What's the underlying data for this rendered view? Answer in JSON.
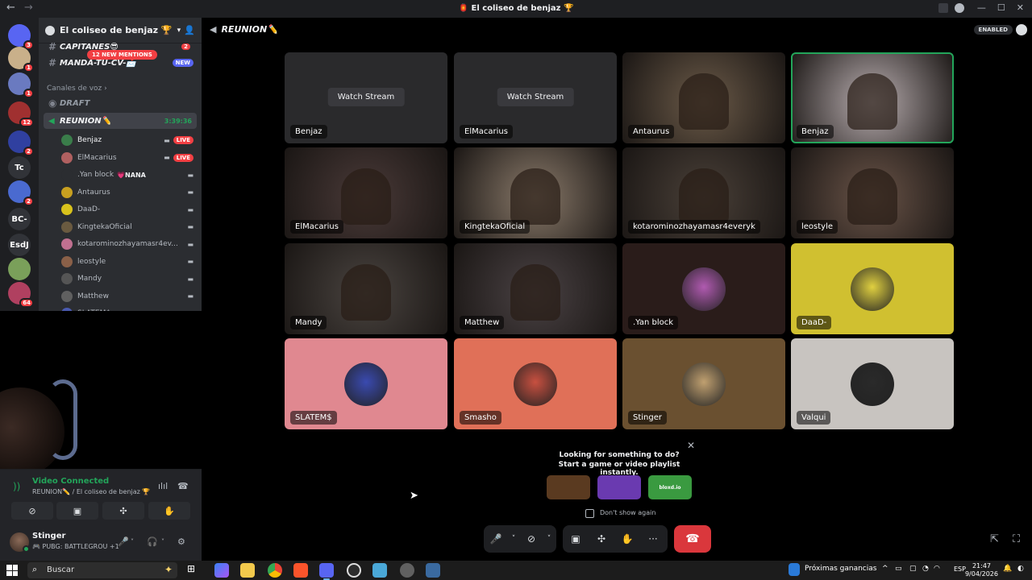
{
  "titlebar": {
    "title": "🏮 El coliseo de benjaz 🏆"
  },
  "server": {
    "name": "El coliseo de benjaz 🏆",
    "mentions_pill": "12 NEW MENTIONS",
    "channels": [
      {
        "name": "CAPITANES😎",
        "badge": "2"
      },
      {
        "name": "MANDA-TU-CV-📩",
        "badge": "NEW"
      }
    ],
    "voice_category": "Canales de voz",
    "voice_channels": [
      {
        "name": "DRAFT"
      },
      {
        "name": "REUNION✏️",
        "timer": "3:39:36"
      }
    ],
    "members": [
      {
        "name": "Benjaz",
        "live": "LIVE",
        "av": "#3a7d4a"
      },
      {
        "name": "ElMacarius",
        "live": "LIVE",
        "av": "#b06060"
      },
      {
        "name": ".Yan block",
        "tag": "💗NANA",
        "av": "#2b2d31"
      },
      {
        "name": "Antaurus",
        "av": "#c8a020"
      },
      {
        "name": "DaaD-",
        "av": "#d8c21c"
      },
      {
        "name": "KingtekaOficial",
        "av": "#6a5a40"
      },
      {
        "name": "kotarominozhayamasr4ev...",
        "av": "#c07090"
      },
      {
        "name": "leostyle",
        "av": "#8a6048"
      },
      {
        "name": "Mandy",
        "av": "#555"
      },
      {
        "name": "Matthew",
        "av": "#606060"
      },
      {
        "name": "SLATEM$",
        "av": "#4a5ab0"
      }
    ],
    "rail": [
      {
        "label": "",
        "badge": "3",
        "color": "#5865f2"
      },
      {
        "label": "",
        "badge": "1",
        "color": "#c9b08a"
      },
      {
        "label": "",
        "badge": "1",
        "color": "#6a7ac0"
      },
      {
        "label": "",
        "badge": "12",
        "color": "#a03030"
      },
      {
        "label": "",
        "badge": "2",
        "color": "#3040a0"
      },
      {
        "label": "Tc",
        "badge": "",
        "color": "#313338"
      },
      {
        "label": "",
        "badge": "2",
        "color": "#4a6ad0"
      },
      {
        "label": "BC-",
        "badge": "",
        "color": "#313338"
      },
      {
        "label": "EsdJ",
        "badge": "",
        "color": "#313338"
      },
      {
        "label": "",
        "badge": "",
        "color": "#7aa05a"
      },
      {
        "label": "",
        "badge": "64",
        "color": "#b04060"
      }
    ]
  },
  "voice_panel": {
    "status": "Video Connected",
    "location": "REUNION✏️ / El coliseo de benjaz 🏆"
  },
  "user": {
    "name": "Stinger",
    "status": "🎮 PUBG: BATTLEGROU +1"
  },
  "main": {
    "channel": "REUNION✏️",
    "enabled_label": "ENABLED",
    "watch_stream_label": "Watch Stream",
    "tiles": [
      {
        "name": "Benjaz",
        "kind": "stream",
        "color": "#2a2a2c"
      },
      {
        "name": "ElMacarius",
        "kind": "stream",
        "color": "#2a2a2c"
      },
      {
        "name": "Antaurus",
        "kind": "video",
        "color": "#6b5a48"
      },
      {
        "name": "Benjaz",
        "kind": "video",
        "color": "#b9aeb0",
        "speaking": true
      },
      {
        "name": "ElMacarius",
        "kind": "video",
        "color": "#4a3a38"
      },
      {
        "name": "KingtekaOficial",
        "kind": "video",
        "color": "#8a7a6a"
      },
      {
        "name": "kotarominozhayamasr4everyk",
        "kind": "video",
        "color": "#4a4038"
      },
      {
        "name": "leostyle",
        "kind": "video",
        "color": "#6a5448"
      },
      {
        "name": "Mandy",
        "kind": "video",
        "color": "#4a4440"
      },
      {
        "name": "Matthew",
        "kind": "video",
        "color": "#4a4244"
      },
      {
        "name": ".Yan block",
        "kind": "avatar",
        "color": "#2a1c1a",
        "av": "#b05ab0"
      },
      {
        "name": "DaaD-",
        "kind": "avatar",
        "color": "#d0c030",
        "av": "#e0d040"
      },
      {
        "name": "SLATEM$",
        "kind": "avatar",
        "color": "#e08890",
        "av": "#3a4ab0"
      },
      {
        "name": "Smasho",
        "kind": "avatar",
        "color": "#e07058",
        "av": "#c85040"
      },
      {
        "name": "Stinger",
        "kind": "avatar",
        "color": "#6a5030",
        "av": "#c0a070"
      },
      {
        "name": "Valqui",
        "kind": "avatar",
        "color": "#c8c4c0",
        "av": "#2a2a2a"
      }
    ]
  },
  "activity_popup": {
    "line1": "Looking for something to do?",
    "line2": "Start a game or video playlist instantly.",
    "games": [
      {
        "label": "",
        "color": "#5a3a20"
      },
      {
        "label": "",
        "color": "#6a3ab0"
      },
      {
        "label": "bloxd.io",
        "color": "#3a9a40"
      }
    ],
    "dont_show": "Don't show again"
  },
  "taskbar": {
    "search_placeholder": "Buscar",
    "news": "Próximas ganancias",
    "lang": "ESP",
    "time": "21:47",
    "date": "9/04/2026"
  }
}
